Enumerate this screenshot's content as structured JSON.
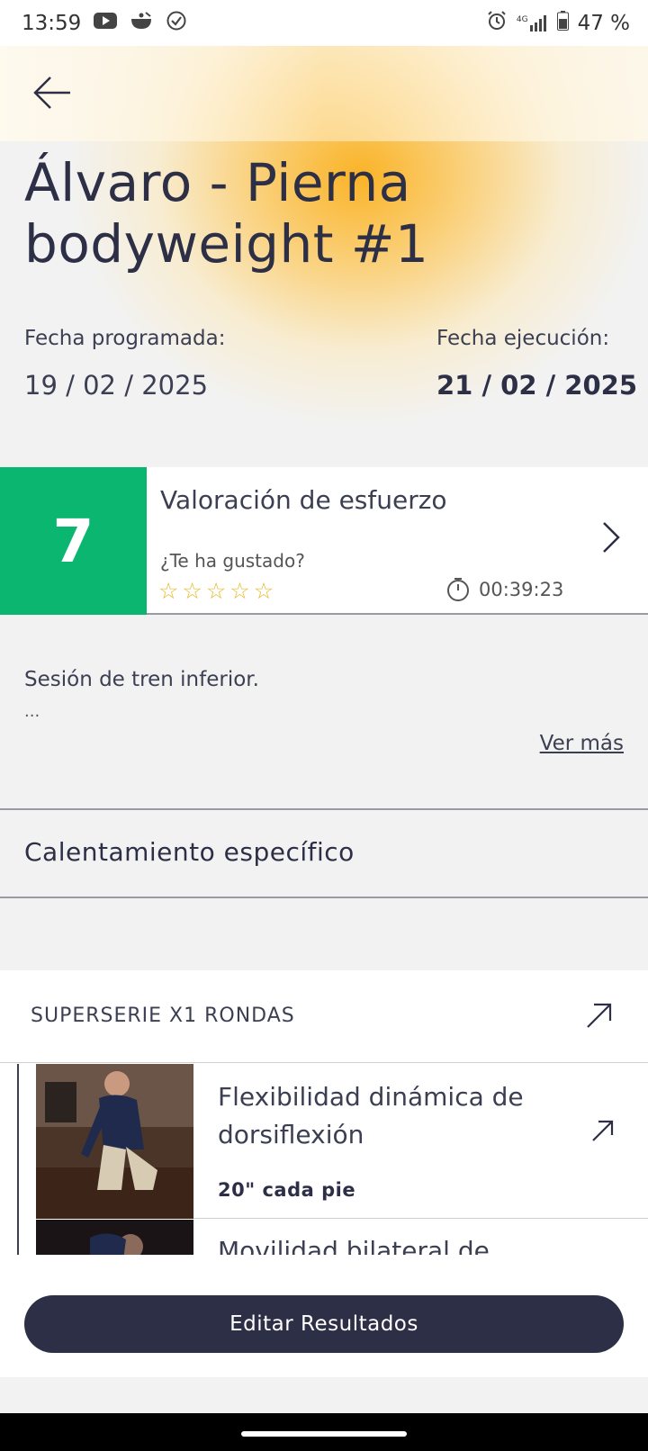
{
  "status_bar": {
    "time": "13:59",
    "battery": "47 %",
    "network": "4G",
    "icons": [
      "youtube-icon",
      "cooking-pot-icon",
      "check-circle-icon",
      "alarm-icon",
      "signal-icon",
      "battery-icon"
    ]
  },
  "header": {
    "back_icon": "arrow-left-icon",
    "title": "Álvaro - Pierna bodyweight #1",
    "scheduled_label": "Fecha programada:",
    "scheduled_date": "19 / 02 / 2025",
    "executed_label": "Fecha ejecución:",
    "executed_date": "21 / 02 / 2025"
  },
  "effort": {
    "score": "7",
    "score_color": "#0bb671",
    "title": "Valoración de esfuerzo",
    "liked_question": "¿Te ha gustado?",
    "stars": [
      "☆",
      "☆",
      "☆",
      "☆",
      "☆"
    ],
    "stars_rating": 0,
    "duration": "00:39:23"
  },
  "description": {
    "text": "Sesión de tren inferior.",
    "ellipsis": "...",
    "more_link": "Ver más"
  },
  "section": {
    "title": "Calentamiento específico"
  },
  "superserie": {
    "label": "SUPERSERIE X1 RONDAS",
    "exercises": [
      {
        "name": "Flexibilidad dinámica de dorsiflexión",
        "reps": "20\" cada pie"
      },
      {
        "name": "Movilidad bilateral de",
        "reps": ""
      }
    ]
  },
  "actions": {
    "edit_results": "Editar Resultados"
  },
  "colors": {
    "primary_dark": "#2c2f45",
    "accent_orange": "#fbb01c",
    "star_yellow": "#e8b82a"
  }
}
